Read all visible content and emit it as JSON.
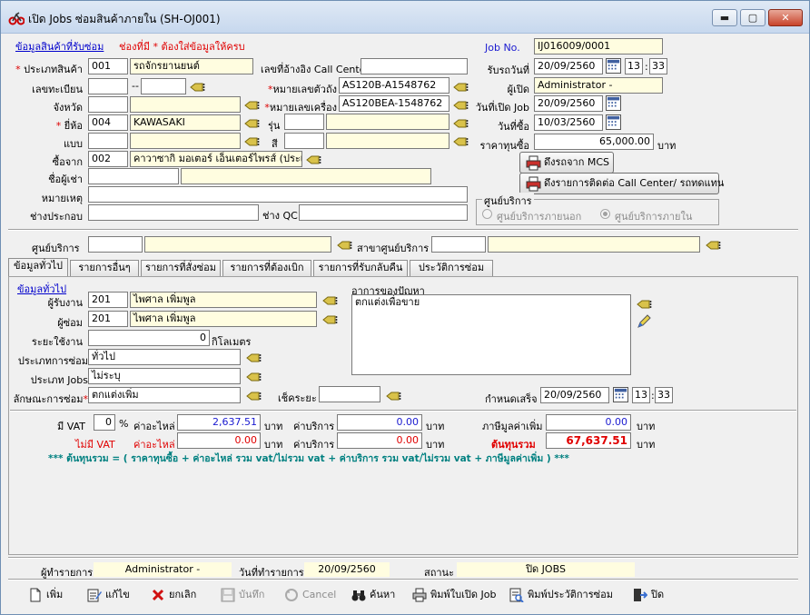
{
  "window": {
    "title": "เปิด Jobs ซ่อมสินค้าภายใน (SH-OJ001)",
    "min": "▬",
    "max": "▢",
    "close": "✕"
  },
  "top": {
    "section_link": "ข้อมูลสินค้าที่รับซ่อม",
    "required_note": "ช่องที่มี * ต้องใส่ข้อมูลให้ครบ",
    "product_type_label": "ประเภทสินค้า",
    "product_type_code": "001",
    "product_type_name": "รถจักรยานยนต์",
    "plate_label": "เลขทะเบียน",
    "plate_sep": "--",
    "province_label": "จังหวัด",
    "brand_label": "ยี่ห้อ",
    "brand_code": "004",
    "brand_name": "KAWASAKI",
    "pattern_label": "แบบ",
    "buy_from_label": "ซื้อจาก",
    "buy_from_code": "002",
    "buy_from_name": "คาวาซากิ มอเตอร์ เอ็นเตอร์ไพรส์ (ประเท",
    "renter_label": "ชื่อผู้เช่า",
    "note_label": "หมายเหตุ",
    "assembler_label": "ช่างประกอบ",
    "callcenter_label": "เลขที่อ้างอิง Call Center",
    "body_no_label": "หมายเลขตัวถัง",
    "body_no": "AS120B-A1548762",
    "engine_no_label": "หมายเลขเครื่อง",
    "engine_no": "AS120BEA-1548762",
    "model_label": "รุ่น",
    "color_label": "สี",
    "qc_label": "ช่าง QC",
    "job_no_label": "Job No.",
    "job_no": "IJ016009/0001",
    "receive_date_label": "รับรถวันที่",
    "receive_date": "20/09/2560",
    "receive_hh": "13",
    "receive_mm": "33",
    "opener_label": "ผู้เปิด",
    "opener": "Administrator -",
    "open_date_label": "วันที่เปิด Job",
    "open_date": "20/09/2560",
    "buy_date_label": "วันที่ซื้อ",
    "buy_date": "10/03/2560",
    "price_label": "ราคาทุนซื้อ",
    "price": "65,000.00",
    "price_unit": "บาท",
    "btn_mcs": "ดึงรถจาก MCS",
    "btn_callcenter": "ดึงรายการติดต่อ Call Center/ รถทดแทน",
    "service_group_label": "ศูนย์บริการ",
    "radio_external": "ศูนย์บริการภายนอก",
    "radio_internal": "ศูนย์บริการภายใน"
  },
  "center": {
    "label": "ศูนย์บริการ",
    "branch_label": "สาขาศูนย์บริการ"
  },
  "tabs": [
    "ข้อมูลทั่วไป",
    "รายการอื่นๆ",
    "รายการที่สั่งซ่อม",
    "รายการที่ต้องเบิก",
    "รายการที่รับกลับคืน",
    "ประวัติการซ่อม"
  ],
  "general": {
    "section_link": "ข้อมูลทั่วไป",
    "receiver_label": "ผู้รับงาน",
    "receiver_code": "201",
    "receiver_name": "ไพศาล เพิ่มพูล",
    "repairer_label": "ผู้ซ่อม",
    "repairer_code": "201",
    "repairer_name": "ไพศาล เพิ่มพูล",
    "distance_label": "ระยะใช้งาน",
    "distance": "0",
    "distance_unit": "กิโลเมตร",
    "repair_type_label": "ประเภทการซ่อม",
    "repair_type": "ทั่วไป",
    "job_type_label": "ประเภท Jobs",
    "job_type": "ไม่ระบุ",
    "repair_nature_label": "ลักษณะการซ่อม",
    "repair_nature": "ตกแต่งเพิ่ม",
    "check_distance_label": "เช็คระยะ",
    "symptom_label": "อาการของปัญหา",
    "symptom": "ตกแต่งเพื่อขาย",
    "due_label": "กำหนดเสร็จ",
    "due_date": "20/09/2560",
    "due_hh": "13",
    "due_mm": "33"
  },
  "totals": {
    "vat_label": "มี VAT",
    "vat_rate": "0",
    "pct": "%",
    "parts_label": "ค่าอะไหล่",
    "parts_vat": "2,637.51",
    "baht": "บาท",
    "service_label": "ค่าบริการ",
    "service_vat": "0.00",
    "vat_amount_label": "ภาษีมูลค่าเพิ่ม",
    "vat_amount": "0.00",
    "novat_label": "ไม่มี VAT",
    "parts_novat": "0.00",
    "service_novat": "0.00",
    "total_label": "ต้นทุนรวม",
    "total": "67,637.51",
    "formula": "*** ต้นทุนรวม = ( ราคาทุนซื้อ + ค่าอะไหล่ รวม vat/ไม่รวม vat + ค่าบริการ รวม vat/ไม่รวม vat + ภาษีมูลค่าเพิ่ม ) ***"
  },
  "status": {
    "maker_label": "ผู้ทำรายการ",
    "maker": "Administrator -",
    "date_label": "วันที่ทำรายการ",
    "date": "20/09/2560",
    "state_label": "สถานะ",
    "state": "ปิด JOBS"
  },
  "toolbar": {
    "add": "เพิ่ม",
    "edit": "แก้ไข",
    "cancel": "ยกเลิก",
    "save": "บันทึก",
    "cancel_en": "Cancel",
    "search": "ค้นหา",
    "print_job": "พิมพ์ใบเปิด Job",
    "print_history": "พิมพ์ประวัติการซ่อม",
    "close": "ปิด"
  },
  "colors": {
    "required": "#dd0000",
    "link": "#0000cc",
    "field_yellow": "#fffde0",
    "total_red": "#e00000",
    "formula_teal": "#008080"
  }
}
